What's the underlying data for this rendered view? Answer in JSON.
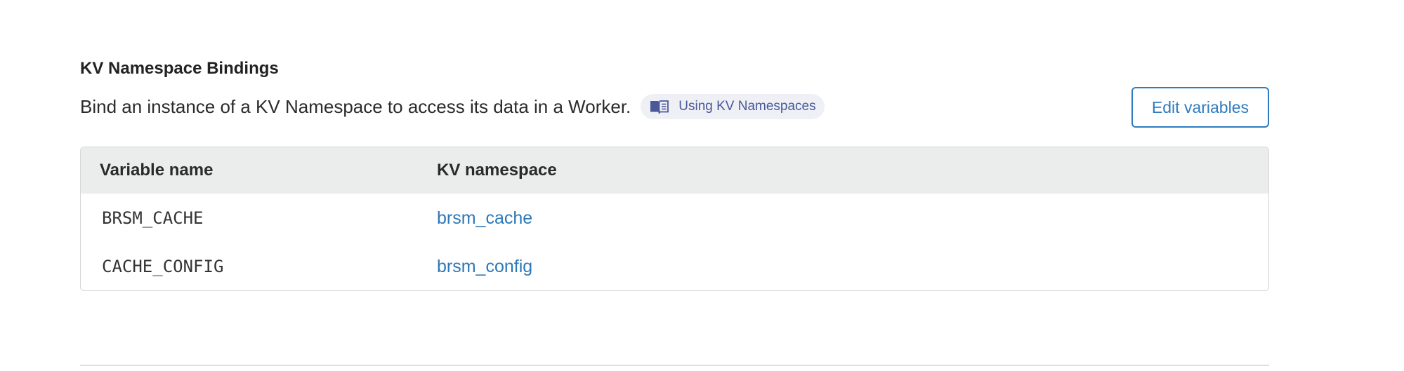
{
  "section": {
    "title": "KV Namespace Bindings",
    "description": "Bind an instance of a KV Namespace to access its data in a Worker.",
    "doc_link": {
      "icon": "book-icon",
      "label": "Using KV Namespaces"
    },
    "edit_button_label": "Edit variables"
  },
  "table": {
    "headers": [
      "Variable name",
      "KV namespace"
    ],
    "rows": [
      {
        "variable": "BRSM_CACHE",
        "namespace": "brsm_cache"
      },
      {
        "variable": "CACHE_CONFIG",
        "namespace": "brsm_config"
      }
    ]
  },
  "colors": {
    "accent": "#2f7bbf",
    "link": "#2c78b8",
    "pill_bg": "#eef0f5",
    "pill_text": "#4a5799",
    "header_bg": "#ebecec"
  }
}
